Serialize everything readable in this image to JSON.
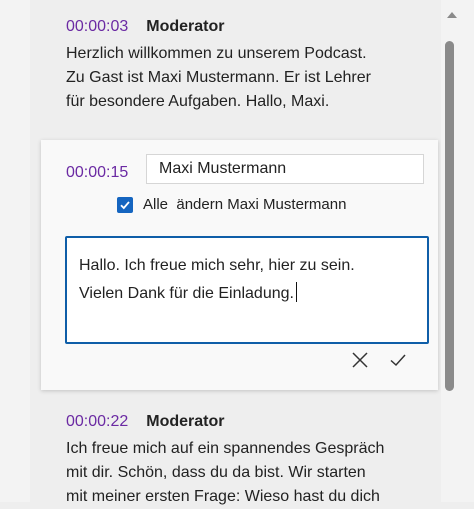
{
  "entries": [
    {
      "timestamp": "00:00:03",
      "speaker": "Moderator",
      "lines": [
        "Herzlich willkommen zu unserem Podcast.",
        "Zu Gast ist Maxi Mustermann. Er ist Lehrer",
        "für besondere Aufgaben. Hallo, Maxi."
      ]
    },
    {
      "timestamp": "00:00:22",
      "speaker": "Moderator",
      "lines": [
        "Ich freue mich auf ein spannendes Gespräch",
        "mit dir. Schön, dass du da bist. Wir starten",
        "mit meiner ersten Frage: Wieso hast du dich"
      ]
    }
  ],
  "editor": {
    "timestamp": "00:00:15",
    "speaker_value": "Maxi Mustermann",
    "checkbox_checked": true,
    "checkbox_label": "Alle  ändern Maxi Mustermann",
    "text_lines": [
      "Hallo. Ich freue mich sehr, hier zu sein.",
      "Vielen Dank für die Einladung."
    ],
    "cancel_icon": "close-icon",
    "confirm_icon": "check-icon"
  },
  "colors": {
    "timestamp": "#6b2aa3",
    "accent": "#1565c0",
    "focus_border": "#0f5ea8"
  }
}
